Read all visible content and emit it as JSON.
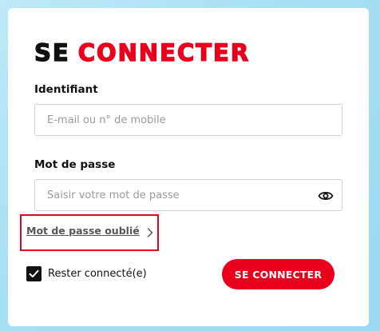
{
  "title": {
    "part1": "SE",
    "part2": "CONNECTER"
  },
  "identifier": {
    "label": "Identifiant",
    "placeholder": "E-mail ou n° de mobile",
    "value": ""
  },
  "password": {
    "label": "Mot de passe",
    "placeholder": "Saisir votre mot de passe",
    "value": "",
    "toggle_icon": "eye-icon"
  },
  "forgot": {
    "label": "Mot de passe oublié",
    "icon": "chevron-right-icon",
    "highlight_color": "#e8001c"
  },
  "remember": {
    "label": "Rester connecté(e)",
    "checked": true
  },
  "submit": {
    "label": "SE CONNECTER"
  },
  "colors": {
    "accent": "#e8001c",
    "text": "#111111",
    "background": "#a7e0f4"
  }
}
